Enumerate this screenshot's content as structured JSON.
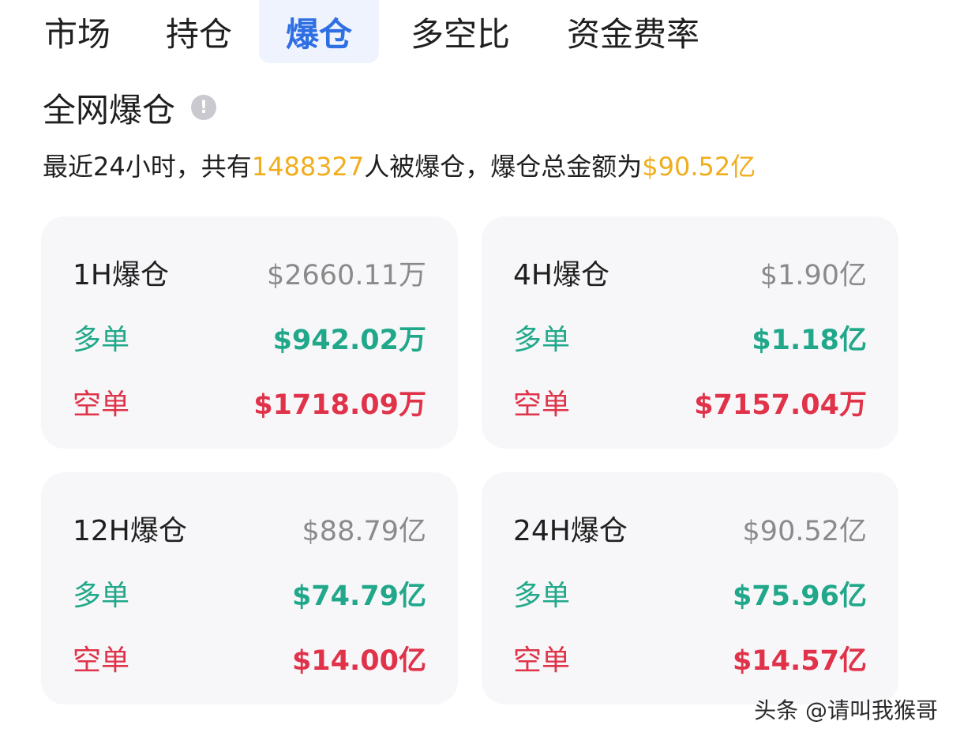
{
  "tabs": [
    {
      "label": "市场",
      "active": false
    },
    {
      "label": "持仓",
      "active": false
    },
    {
      "label": "爆仓",
      "active": true
    },
    {
      "label": "多空比",
      "active": false
    },
    {
      "label": "资金费率",
      "active": false
    }
  ],
  "section": {
    "title": "全网爆仓",
    "info_icon": "!"
  },
  "summary": {
    "prefix": "最近24小时，共有",
    "people_count": "1488327",
    "middle": "人被爆仓，爆仓总金额为",
    "total_amount": "$90.52亿"
  },
  "cards": [
    {
      "label": "1H爆仓",
      "total": "$2660.11万",
      "long_label": "多单",
      "long_value": "$942.02万",
      "short_label": "空单",
      "short_value": "$1718.09万"
    },
    {
      "label": "4H爆仓",
      "total": "$1.90亿",
      "long_label": "多单",
      "long_value": "$1.18亿",
      "short_label": "空单",
      "short_value": "$7157.04万"
    },
    {
      "label": "12H爆仓",
      "total": "$88.79亿",
      "long_label": "多单",
      "long_value": "$74.79亿",
      "short_label": "空单",
      "short_value": "$14.00亿"
    },
    {
      "label": "24H爆仓",
      "total": "$90.52亿",
      "long_label": "多单",
      "long_value": "$75.96亿",
      "short_label": "空单",
      "short_value": "$14.57亿"
    }
  ],
  "colors": {
    "active_tab": "#2f6fe4",
    "highlight": "#f0ad1c",
    "long": "#21a88a",
    "short": "#e0334a",
    "muted": "#8a8a8a"
  },
  "watermark": "头条 @请叫我猴哥"
}
